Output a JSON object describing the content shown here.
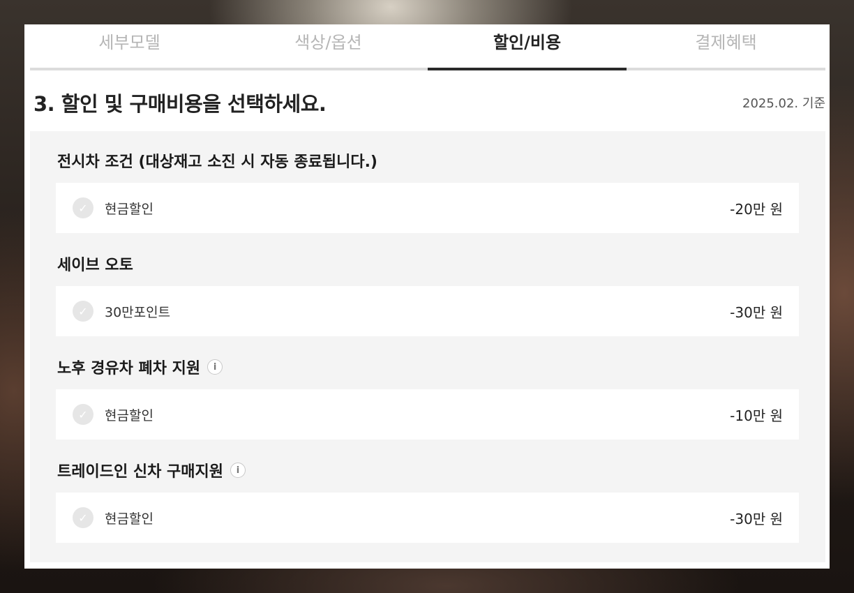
{
  "tabs": [
    {
      "label": "세부모델",
      "active": false
    },
    {
      "label": "색상/옵션",
      "active": false
    },
    {
      "label": "할인/비용",
      "active": true
    },
    {
      "label": "결제혜택",
      "active": false
    }
  ],
  "section": {
    "title": "3. 할인 및 구매비용을 선택하세요.",
    "date": "2025.02. 기준"
  },
  "groups": [
    {
      "title": "전시차 조건 (대상재고 소진 시 자동 종료됩니다.)",
      "info": false,
      "option": {
        "label": "현금할인",
        "amount": "-20만 원",
        "selected": false
      }
    },
    {
      "title": "세이브 오토",
      "info": false,
      "option": {
        "label": "30만포인트",
        "amount": "-30만 원",
        "selected": false
      }
    },
    {
      "title": "노후 경유차 폐차 지원",
      "info": true,
      "option": {
        "label": "현금할인",
        "amount": "-10만 원",
        "selected": false
      }
    },
    {
      "title": "트레이드인 신차 구매지원",
      "info": true,
      "option": {
        "label": "현금할인",
        "amount": "-30만 원",
        "selected": false
      }
    }
  ],
  "icons": {
    "check": "check-icon",
    "info": "info-icon"
  },
  "colors": {
    "active_tab_underline": "#2a2a2a",
    "inactive_tab_text": "#b5b5b5",
    "panel_bg": "#f4f4f4"
  }
}
